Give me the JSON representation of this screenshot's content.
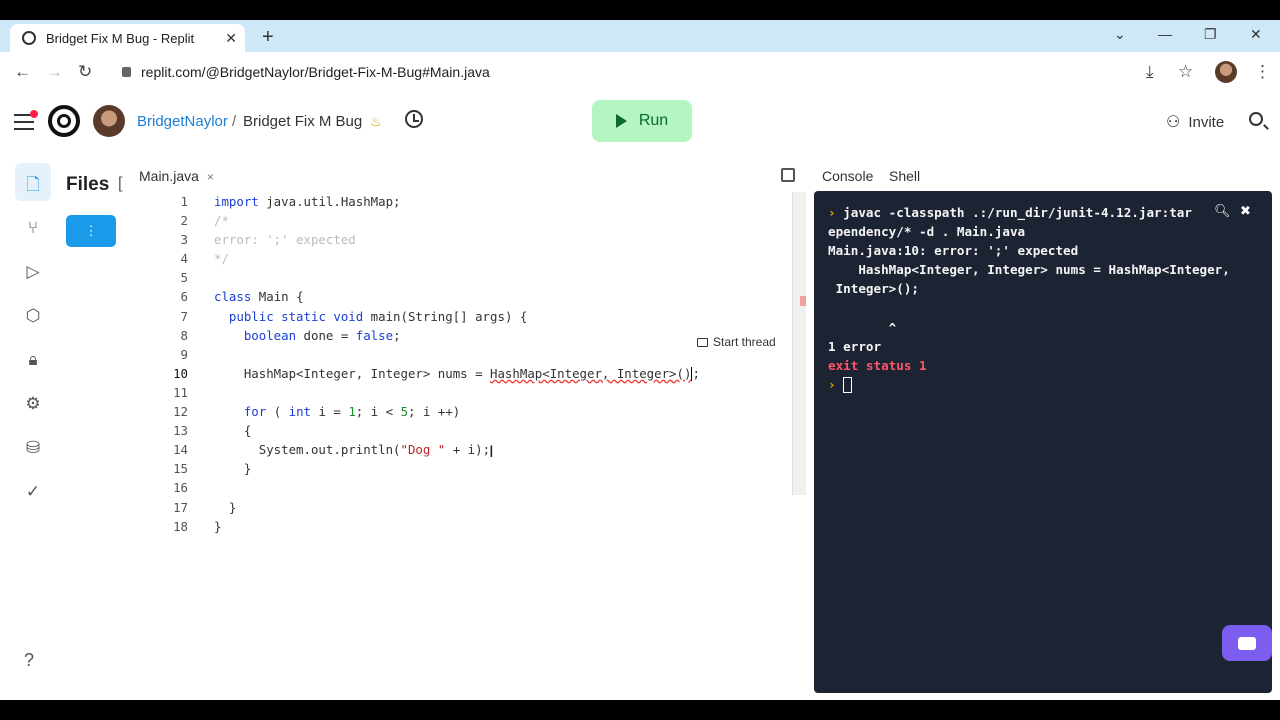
{
  "browser": {
    "tab_title": "Bridget Fix M Bug - Replit",
    "url": "replit.com/@BridgetNaylor/Bridget-Fix-M-Bug#Main.java"
  },
  "header": {
    "user": "BridgetNaylor",
    "separator": "/",
    "repl_name": "Bridget Fix M Bug",
    "run_label": "Run",
    "invite_label": "Invite"
  },
  "sidebar": {
    "title": "Files",
    "bracket": "[",
    "help": "?"
  },
  "editor": {
    "tab": "Main.java",
    "tab_close": "×",
    "start_thread": "Start thread",
    "line_numbers": [
      "1",
      "2",
      "3",
      "4",
      "5",
      "6",
      "7",
      "8",
      "9",
      "10",
      "11",
      "12",
      "13",
      "14",
      "15",
      "16",
      "17",
      "18"
    ]
  },
  "console": {
    "tab_console": "Console",
    "tab_shell": "Shell",
    "lines": [
      "javac -classpath .:/run_dir/junit-4.12.jar:tar",
      "ependency/* -d . Main.java",
      "Main.java:10: error: ';' expected",
      "    HashMap<Integer, Integer> nums = HashMap<Integer,",
      " Integer>();",
      "",
      "        ^",
      "1 error",
      "exit status 1"
    ]
  },
  "colors": {
    "accent": "#1a9ae8",
    "run_bg": "#b4f5c1",
    "console_bg": "#1c2333",
    "error_red": "#ff5568"
  }
}
